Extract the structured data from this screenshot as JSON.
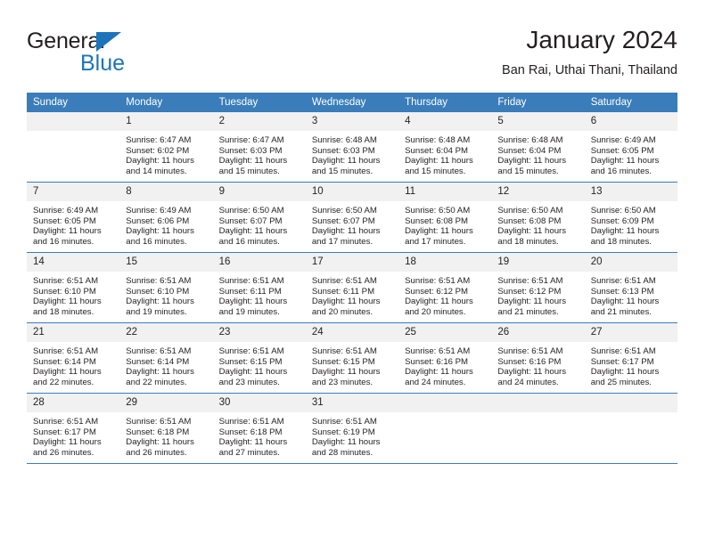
{
  "logo": {
    "word1": "General",
    "word2": "Blue",
    "accent_color": "#1b75bb"
  },
  "header": {
    "title": "January 2024",
    "subtitle": "Ban Rai, Uthai Thani, Thailand"
  },
  "theme": {
    "header_bg": "#3a7dba",
    "header_text": "#ffffff",
    "daynum_bg": "#f1f1f1",
    "border": "#3a7dba",
    "text": "#231f20"
  },
  "weekday_headers": [
    "Sunday",
    "Monday",
    "Tuesday",
    "Wednesday",
    "Thursday",
    "Friday",
    "Saturday"
  ],
  "weeks": [
    [
      {
        "day": "",
        "blank": true,
        "sunrise": "",
        "sunset": "",
        "daylight1": "",
        "daylight2": ""
      },
      {
        "day": "1",
        "sunrise": "Sunrise: 6:47 AM",
        "sunset": "Sunset: 6:02 PM",
        "daylight1": "Daylight: 11 hours",
        "daylight2": "and 14 minutes."
      },
      {
        "day": "2",
        "sunrise": "Sunrise: 6:47 AM",
        "sunset": "Sunset: 6:03 PM",
        "daylight1": "Daylight: 11 hours",
        "daylight2": "and 15 minutes."
      },
      {
        "day": "3",
        "sunrise": "Sunrise: 6:48 AM",
        "sunset": "Sunset: 6:03 PM",
        "daylight1": "Daylight: 11 hours",
        "daylight2": "and 15 minutes."
      },
      {
        "day": "4",
        "sunrise": "Sunrise: 6:48 AM",
        "sunset": "Sunset: 6:04 PM",
        "daylight1": "Daylight: 11 hours",
        "daylight2": "and 15 minutes."
      },
      {
        "day": "5",
        "sunrise": "Sunrise: 6:48 AM",
        "sunset": "Sunset: 6:04 PM",
        "daylight1": "Daylight: 11 hours",
        "daylight2": "and 15 minutes."
      },
      {
        "day": "6",
        "sunrise": "Sunrise: 6:49 AM",
        "sunset": "Sunset: 6:05 PM",
        "daylight1": "Daylight: 11 hours",
        "daylight2": "and 16 minutes."
      }
    ],
    [
      {
        "day": "7",
        "sunrise": "Sunrise: 6:49 AM",
        "sunset": "Sunset: 6:05 PM",
        "daylight1": "Daylight: 11 hours",
        "daylight2": "and 16 minutes."
      },
      {
        "day": "8",
        "sunrise": "Sunrise: 6:49 AM",
        "sunset": "Sunset: 6:06 PM",
        "daylight1": "Daylight: 11 hours",
        "daylight2": "and 16 minutes."
      },
      {
        "day": "9",
        "sunrise": "Sunrise: 6:50 AM",
        "sunset": "Sunset: 6:07 PM",
        "daylight1": "Daylight: 11 hours",
        "daylight2": "and 16 minutes."
      },
      {
        "day": "10",
        "sunrise": "Sunrise: 6:50 AM",
        "sunset": "Sunset: 6:07 PM",
        "daylight1": "Daylight: 11 hours",
        "daylight2": "and 17 minutes."
      },
      {
        "day": "11",
        "sunrise": "Sunrise: 6:50 AM",
        "sunset": "Sunset: 6:08 PM",
        "daylight1": "Daylight: 11 hours",
        "daylight2": "and 17 minutes."
      },
      {
        "day": "12",
        "sunrise": "Sunrise: 6:50 AM",
        "sunset": "Sunset: 6:08 PM",
        "daylight1": "Daylight: 11 hours",
        "daylight2": "and 18 minutes."
      },
      {
        "day": "13",
        "sunrise": "Sunrise: 6:50 AM",
        "sunset": "Sunset: 6:09 PM",
        "daylight1": "Daylight: 11 hours",
        "daylight2": "and 18 minutes."
      }
    ],
    [
      {
        "day": "14",
        "sunrise": "Sunrise: 6:51 AM",
        "sunset": "Sunset: 6:10 PM",
        "daylight1": "Daylight: 11 hours",
        "daylight2": "and 18 minutes."
      },
      {
        "day": "15",
        "sunrise": "Sunrise: 6:51 AM",
        "sunset": "Sunset: 6:10 PM",
        "daylight1": "Daylight: 11 hours",
        "daylight2": "and 19 minutes."
      },
      {
        "day": "16",
        "sunrise": "Sunrise: 6:51 AM",
        "sunset": "Sunset: 6:11 PM",
        "daylight1": "Daylight: 11 hours",
        "daylight2": "and 19 minutes."
      },
      {
        "day": "17",
        "sunrise": "Sunrise: 6:51 AM",
        "sunset": "Sunset: 6:11 PM",
        "daylight1": "Daylight: 11 hours",
        "daylight2": "and 20 minutes."
      },
      {
        "day": "18",
        "sunrise": "Sunrise: 6:51 AM",
        "sunset": "Sunset: 6:12 PM",
        "daylight1": "Daylight: 11 hours",
        "daylight2": "and 20 minutes."
      },
      {
        "day": "19",
        "sunrise": "Sunrise: 6:51 AM",
        "sunset": "Sunset: 6:12 PM",
        "daylight1": "Daylight: 11 hours",
        "daylight2": "and 21 minutes."
      },
      {
        "day": "20",
        "sunrise": "Sunrise: 6:51 AM",
        "sunset": "Sunset: 6:13 PM",
        "daylight1": "Daylight: 11 hours",
        "daylight2": "and 21 minutes."
      }
    ],
    [
      {
        "day": "21",
        "sunrise": "Sunrise: 6:51 AM",
        "sunset": "Sunset: 6:14 PM",
        "daylight1": "Daylight: 11 hours",
        "daylight2": "and 22 minutes."
      },
      {
        "day": "22",
        "sunrise": "Sunrise: 6:51 AM",
        "sunset": "Sunset: 6:14 PM",
        "daylight1": "Daylight: 11 hours",
        "daylight2": "and 22 minutes."
      },
      {
        "day": "23",
        "sunrise": "Sunrise: 6:51 AM",
        "sunset": "Sunset: 6:15 PM",
        "daylight1": "Daylight: 11 hours",
        "daylight2": "and 23 minutes."
      },
      {
        "day": "24",
        "sunrise": "Sunrise: 6:51 AM",
        "sunset": "Sunset: 6:15 PM",
        "daylight1": "Daylight: 11 hours",
        "daylight2": "and 23 minutes."
      },
      {
        "day": "25",
        "sunrise": "Sunrise: 6:51 AM",
        "sunset": "Sunset: 6:16 PM",
        "daylight1": "Daylight: 11 hours",
        "daylight2": "and 24 minutes."
      },
      {
        "day": "26",
        "sunrise": "Sunrise: 6:51 AM",
        "sunset": "Sunset: 6:16 PM",
        "daylight1": "Daylight: 11 hours",
        "daylight2": "and 24 minutes."
      },
      {
        "day": "27",
        "sunrise": "Sunrise: 6:51 AM",
        "sunset": "Sunset: 6:17 PM",
        "daylight1": "Daylight: 11 hours",
        "daylight2": "and 25 minutes."
      }
    ],
    [
      {
        "day": "28",
        "sunrise": "Sunrise: 6:51 AM",
        "sunset": "Sunset: 6:17 PM",
        "daylight1": "Daylight: 11 hours",
        "daylight2": "and 26 minutes."
      },
      {
        "day": "29",
        "sunrise": "Sunrise: 6:51 AM",
        "sunset": "Sunset: 6:18 PM",
        "daylight1": "Daylight: 11 hours",
        "daylight2": "and 26 minutes."
      },
      {
        "day": "30",
        "sunrise": "Sunrise: 6:51 AM",
        "sunset": "Sunset: 6:18 PM",
        "daylight1": "Daylight: 11 hours",
        "daylight2": "and 27 minutes."
      },
      {
        "day": "31",
        "sunrise": "Sunrise: 6:51 AM",
        "sunset": "Sunset: 6:19 PM",
        "daylight1": "Daylight: 11 hours",
        "daylight2": "and 28 minutes."
      },
      {
        "day": "",
        "blank": true,
        "sunrise": "",
        "sunset": "",
        "daylight1": "",
        "daylight2": ""
      },
      {
        "day": "",
        "blank": true,
        "sunrise": "",
        "sunset": "",
        "daylight1": "",
        "daylight2": ""
      },
      {
        "day": "",
        "blank": true,
        "sunrise": "",
        "sunset": "",
        "daylight1": "",
        "daylight2": ""
      }
    ]
  ]
}
